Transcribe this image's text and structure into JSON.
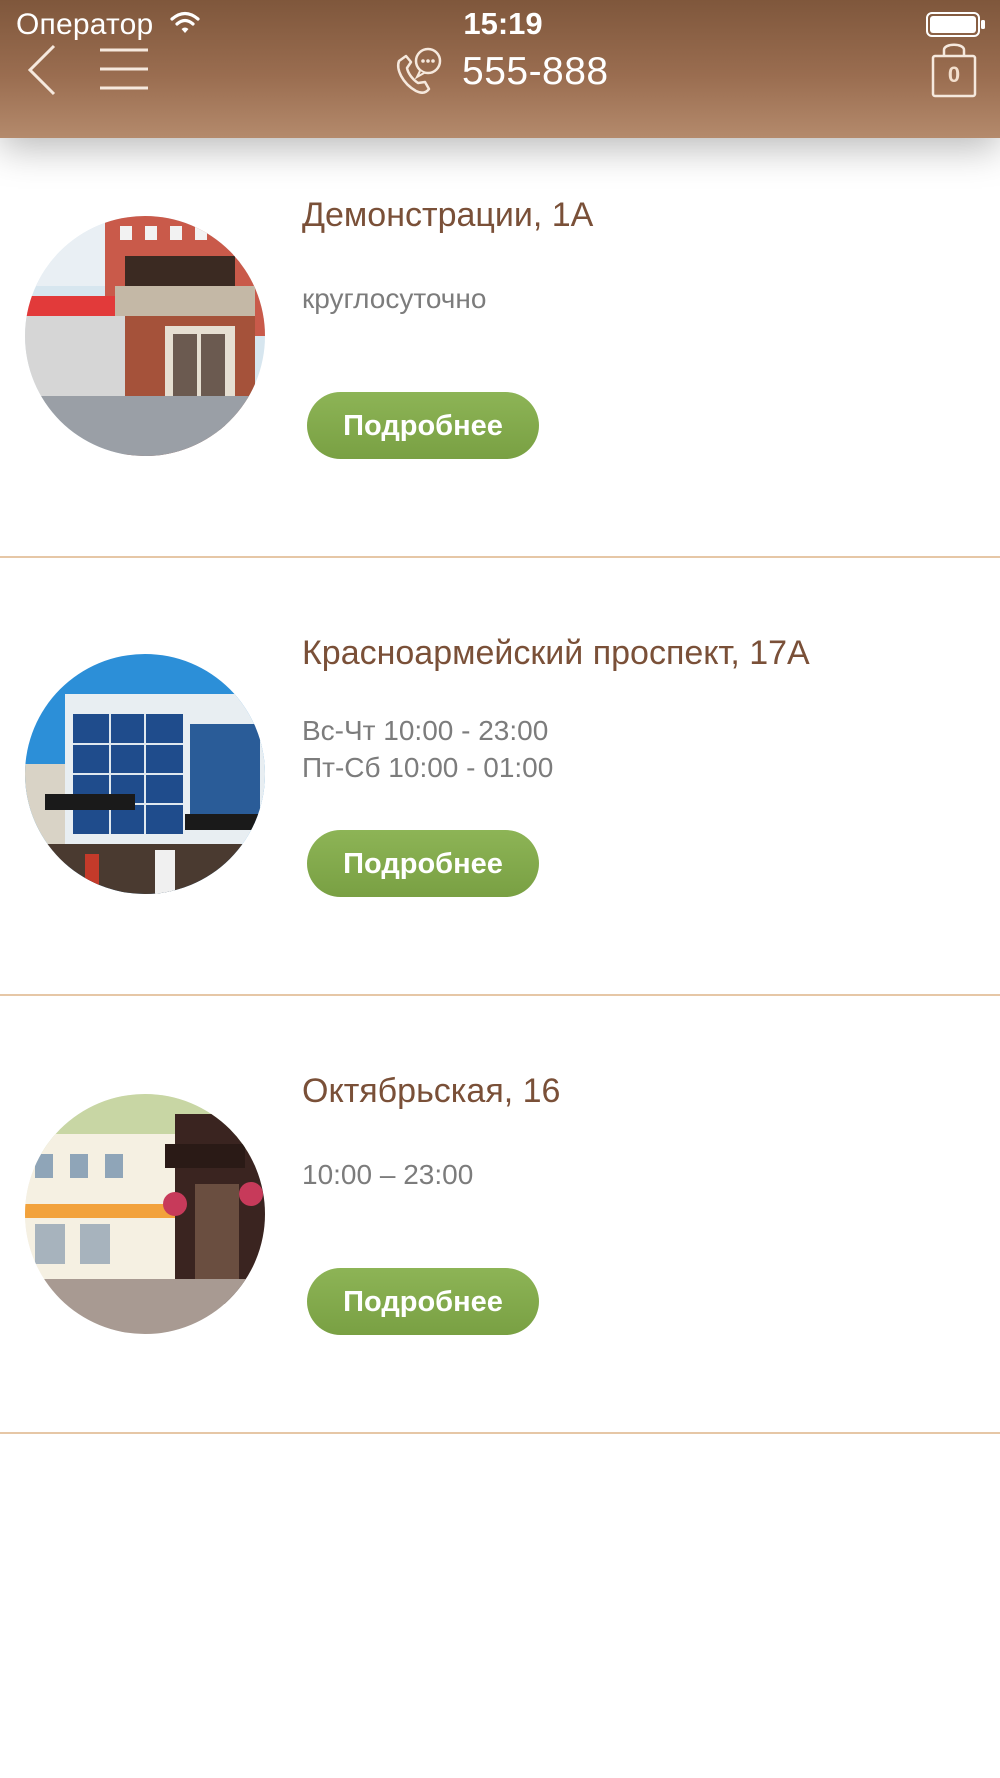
{
  "status_bar": {
    "carrier": "Оператор",
    "time": "15:19"
  },
  "header": {
    "phone": "555-888",
    "cart_count": "0",
    "background_color": "#946a4d"
  },
  "locations": [
    {
      "address": "Демонстрации, 1А",
      "hours": [
        "круглосуточно"
      ],
      "button_label": "Подробнее"
    },
    {
      "address": "Красноармейский проспект, 17А",
      "hours": [
        "Вс-Чт 10:00 - 23:00",
        "Пт-Сб 10:00 - 01:00"
      ],
      "button_label": "Подробнее"
    },
    {
      "address": "Октябрьская, 16",
      "hours": [
        "10:00 – 23:00"
      ],
      "button_label": "Подробнее"
    }
  ],
  "colors": {
    "button": "#82aa4c",
    "address_text": "#7a5038",
    "hours_text": "#7c7c7c",
    "separator": "#e6c7a6"
  }
}
